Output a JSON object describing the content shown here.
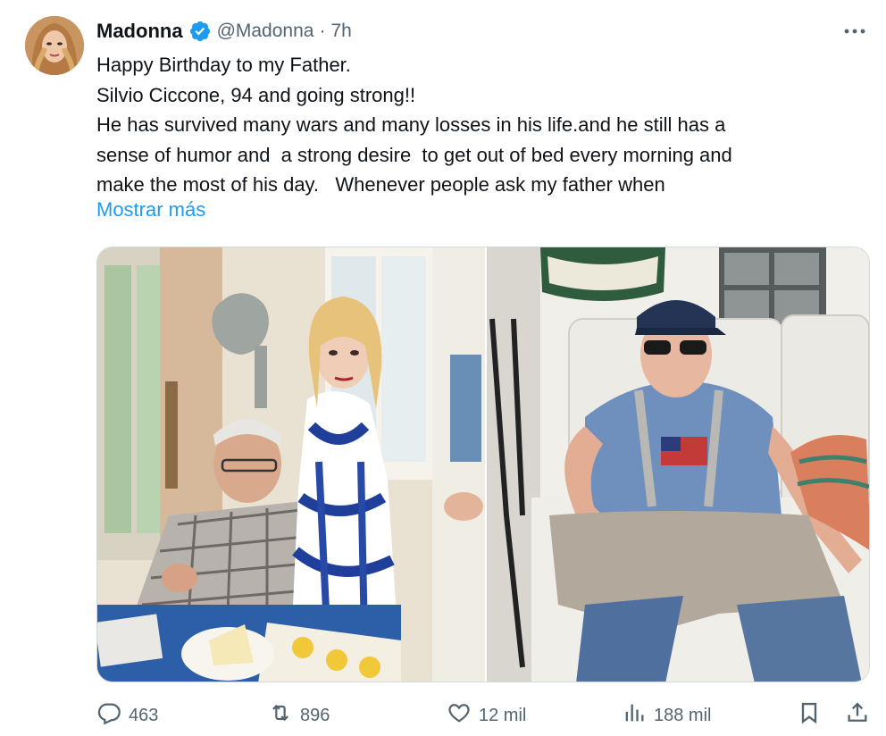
{
  "tweet": {
    "author": {
      "name": "Madonna",
      "handle": "@Madonna",
      "separator": "·",
      "time": "7h",
      "verified": true
    },
    "more_icon": "more-icon",
    "lines": [
      "Happy Birthday to my Father.",
      "Silvio Ciccone, 94 and going strong!!",
      "He has survived many wars and many losses in his life.and he still has a",
      "sense of humor and  a strong desire  to get out of bed every morning and",
      "make the most of his day.   Whenever people ask my father when"
    ],
    "show_more": "Mostrar más",
    "media": [
      {
        "name": "photo-left",
        "alt": ""
      },
      {
        "name": "photo-right",
        "alt": ""
      }
    ],
    "actions": {
      "replies": "463",
      "retweets": "896",
      "likes": "12 mil",
      "views": "188 mil"
    }
  },
  "colors": {
    "text": "#0f1419",
    "secondary": "#536471",
    "link": "#1d9bf0",
    "verified": "#1d9bf0",
    "border": "#cfd9de"
  }
}
